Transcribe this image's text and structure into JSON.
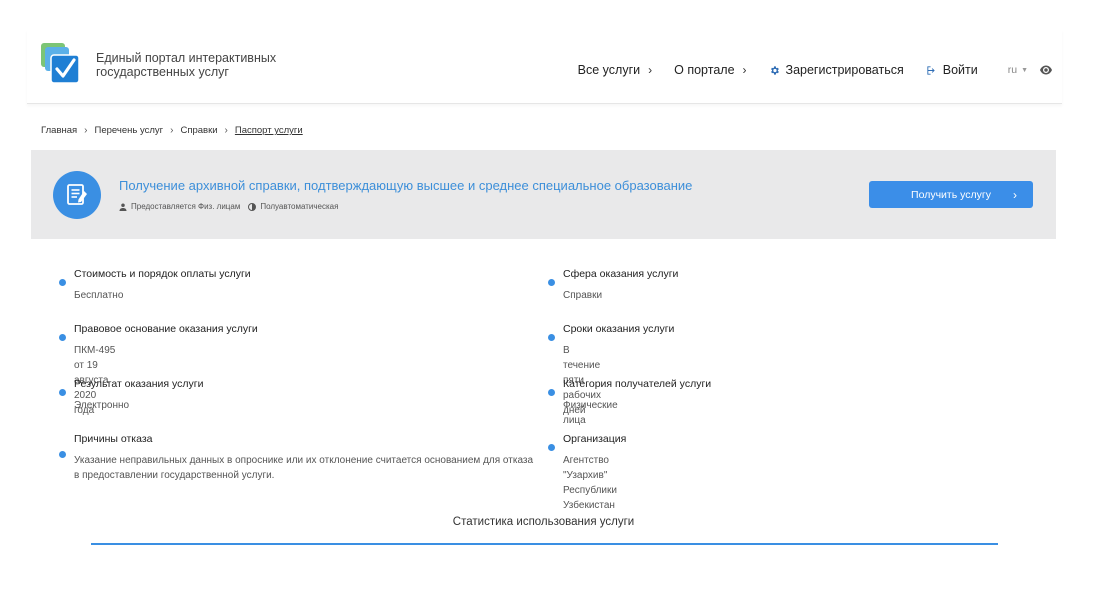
{
  "header": {
    "portal_title": "Единый портал интерактивных государственных услуг",
    "nav": {
      "services": "Все услуги",
      "about": "О портале",
      "register": "Зарегистрироваться",
      "login": "Войти"
    },
    "lang": "ru",
    "icons": [
      "logo-checkmark-icon",
      "gear-icon",
      "sign-in-icon",
      "eye-icon"
    ]
  },
  "breadcrumb": {
    "items": [
      "Главная",
      "Перечень услуг",
      "Справки"
    ],
    "current": "Паспорт услуги"
  },
  "service": {
    "title": "Получение архивной справки, подтверждающую высшее и среднее специальное образование",
    "provided_to": "Предоставляется Физ. лицам",
    "mode": "Полуавтоматическая",
    "get_button": "Получить услугу"
  },
  "details": {
    "left": [
      {
        "label": "Стоимость и порядок оплаты услуги",
        "value": "Бесплатно"
      },
      {
        "label": "Правовое основание оказания услуги",
        "value": "ПКМ-495 от 19 августа 2020 года"
      },
      {
        "label": "Результат оказания услуги",
        "value": "Электронно"
      },
      {
        "label": "Причины отказа",
        "value": "Указание неправильных данных в опроснике или их отклонение считается основанием для отказа в предоставлении государственной услуги."
      }
    ],
    "right": [
      {
        "label": "Сфера оказания услуги",
        "value": "Справки"
      },
      {
        "label": "Сроки оказания услуги",
        "value": "В течение пяти рабочих дней"
      },
      {
        "label": "Категория получателей услуги",
        "value": "Физические лица"
      },
      {
        "label": "Организация",
        "value": "Агентство \"Узархив\" Республики Узбекистан"
      }
    ]
  },
  "stats": {
    "title": "Статистика использования услуги"
  },
  "colors": {
    "accent": "#3a8fe3",
    "banner_bg": "#e9e9ea",
    "title_blue": "#3d8fd9"
  }
}
